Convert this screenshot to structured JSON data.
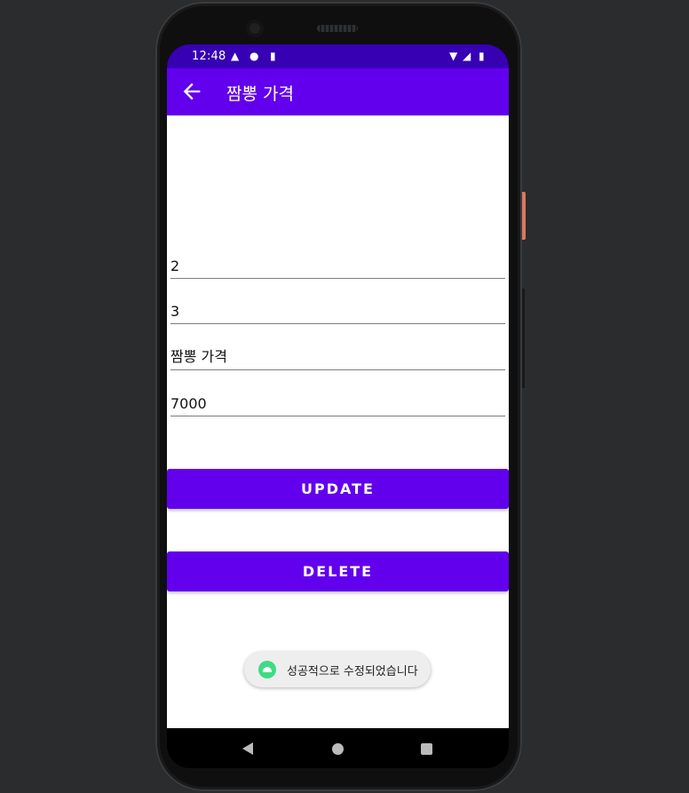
{
  "status_bar": {
    "time": "12:48",
    "icons": [
      "warning-icon",
      "message-icon",
      "sd-card-icon",
      "wifi-icon",
      "signal-icon",
      "battery-icon"
    ]
  },
  "toolbar": {
    "title": "짬뽕 가격",
    "back_icon": "arrow-back-icon"
  },
  "form": {
    "field1_value": "2",
    "field2_value": "3",
    "field3_value": "짬뽕 가격",
    "field4_value": "7000"
  },
  "buttons": {
    "update_label": "UPDATE",
    "delete_label": "DELETE"
  },
  "toast": {
    "message": "성공적으로 수정되었습니다"
  },
  "colors": {
    "primary": "#6200ee",
    "primary_dark": "#3700b3"
  }
}
